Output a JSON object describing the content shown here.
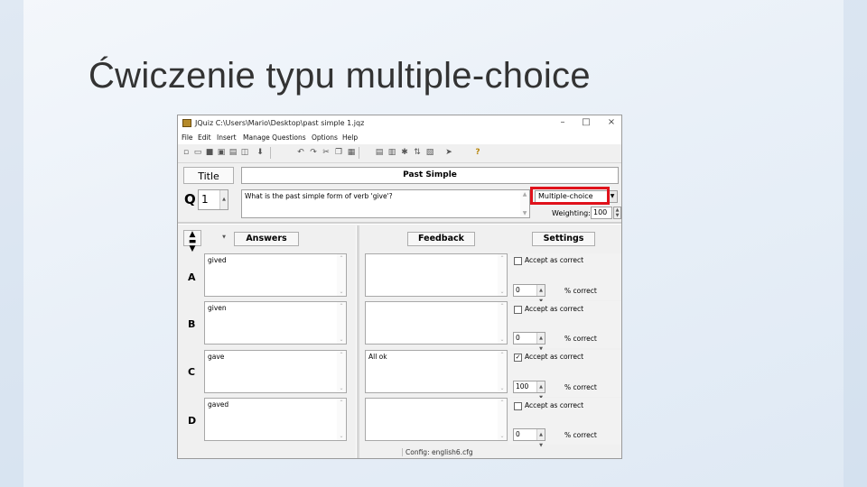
{
  "slide": {
    "title": "Ćwiczenie typu multiple-choice"
  },
  "window": {
    "title": "JQuiz C:\\Users\\Mario\\Desktop\\past simple 1.jqz",
    "minimize": "–",
    "maximize": "□",
    "close": "×"
  },
  "menu": [
    "File",
    "Edit",
    "Insert",
    "Manage Questions",
    "Options",
    "Help"
  ],
  "toolbar_icons": [
    "new-icon",
    "open-icon",
    "save-icon",
    "save-as-icon",
    "printer-icon",
    "web-page-icon",
    "arrow-down-icon",
    "undo-icon",
    "redo-icon",
    "cut-icon",
    "copy-icon",
    "paste-icon",
    "tools-icon",
    "grid-icon",
    "image-icon",
    "tools-icon-2",
    "sort-icon",
    "export-icon",
    "arrow-icon",
    "help-icon"
  ],
  "editor": {
    "title_label": "Title",
    "title_value": "Past Simple",
    "question_number_label": "Q",
    "question_number": "1",
    "question_text": "What is the past simple form of verb 'give'?",
    "question_type": "Multiple-choice",
    "weighting_label": "Weighting:",
    "weighting_value": "100"
  },
  "headers": {
    "answers": "Answers",
    "feedback": "Feedback",
    "settings": "Settings"
  },
  "answers": [
    {
      "letter": "A",
      "text": "gived",
      "feedback": "",
      "accept_label": "Accept as correct",
      "accept_checked": false,
      "percent": "0",
      "percent_label": "% correct"
    },
    {
      "letter": "B",
      "text": "given",
      "feedback": "",
      "accept_label": "Accept as correct",
      "accept_checked": false,
      "percent": "0",
      "percent_label": "% correct"
    },
    {
      "letter": "C",
      "text": "gave",
      "feedback": "All ok",
      "accept_label": "Accept as correct",
      "accept_checked": true,
      "percent": "100",
      "percent_label": "% correct"
    },
    {
      "letter": "D",
      "text": "gaved",
      "feedback": "",
      "accept_label": "Accept as correct",
      "accept_checked": false,
      "percent": "0",
      "percent_label": "% correct"
    }
  ],
  "status": {
    "config": "Config: english6.cfg"
  },
  "colors": {
    "highlight": "#e0121b"
  }
}
